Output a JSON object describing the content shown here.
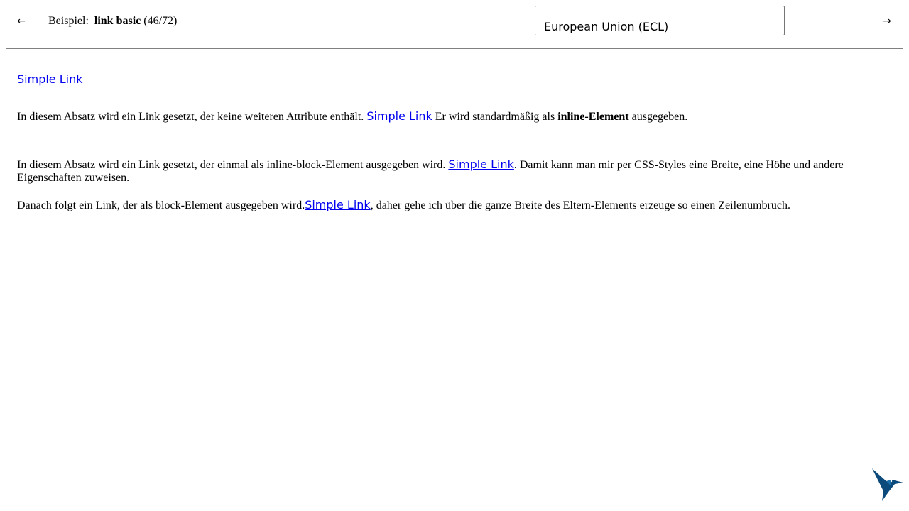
{
  "toolbar": {
    "prev_icon": "arrow-left-icon",
    "prev_glyph": "←",
    "example_prefix": "Beispiel:",
    "example_name": "link basic",
    "example_counter": "(46/72)",
    "theme_selected": "European Union (ECL)",
    "next_icon": "arrow-right-icon",
    "next_glyph": "→"
  },
  "content": {
    "standalone_link": "Simple Link",
    "p1": {
      "before": "In diesem Absatz wird ein Link gesetzt, der keine weiteren Attribute enthält. ",
      "link": "Simple Link",
      "middle": " Er wird standardmäßig als ",
      "bold": "inline-Element",
      "after": " ausgegeben."
    },
    "p2": {
      "before": "In diesem Absatz wird ein Link gesetzt, der einmal als inline-block-Element ausgegeben wird. ",
      "link": "Simple Link",
      "after": ". Damit kann man mir per CSS-Styles eine Breite, eine Höhe und andere Eigenschaften zuweisen."
    },
    "p3": {
      "before": "Danach folgt ein Link, der als block-Element ausgegeben wird.",
      "link": "Simple Link",
      "after": ", daher gehe ich über die ganze Breite des Eltern-Elements erzeuge so einen Zeilenumbruch."
    }
  },
  "colors": {
    "link": "#0000ee",
    "logo": "#0b4a7a",
    "divider": "#808080"
  },
  "logo_icon": "hummingbird-logo-icon"
}
